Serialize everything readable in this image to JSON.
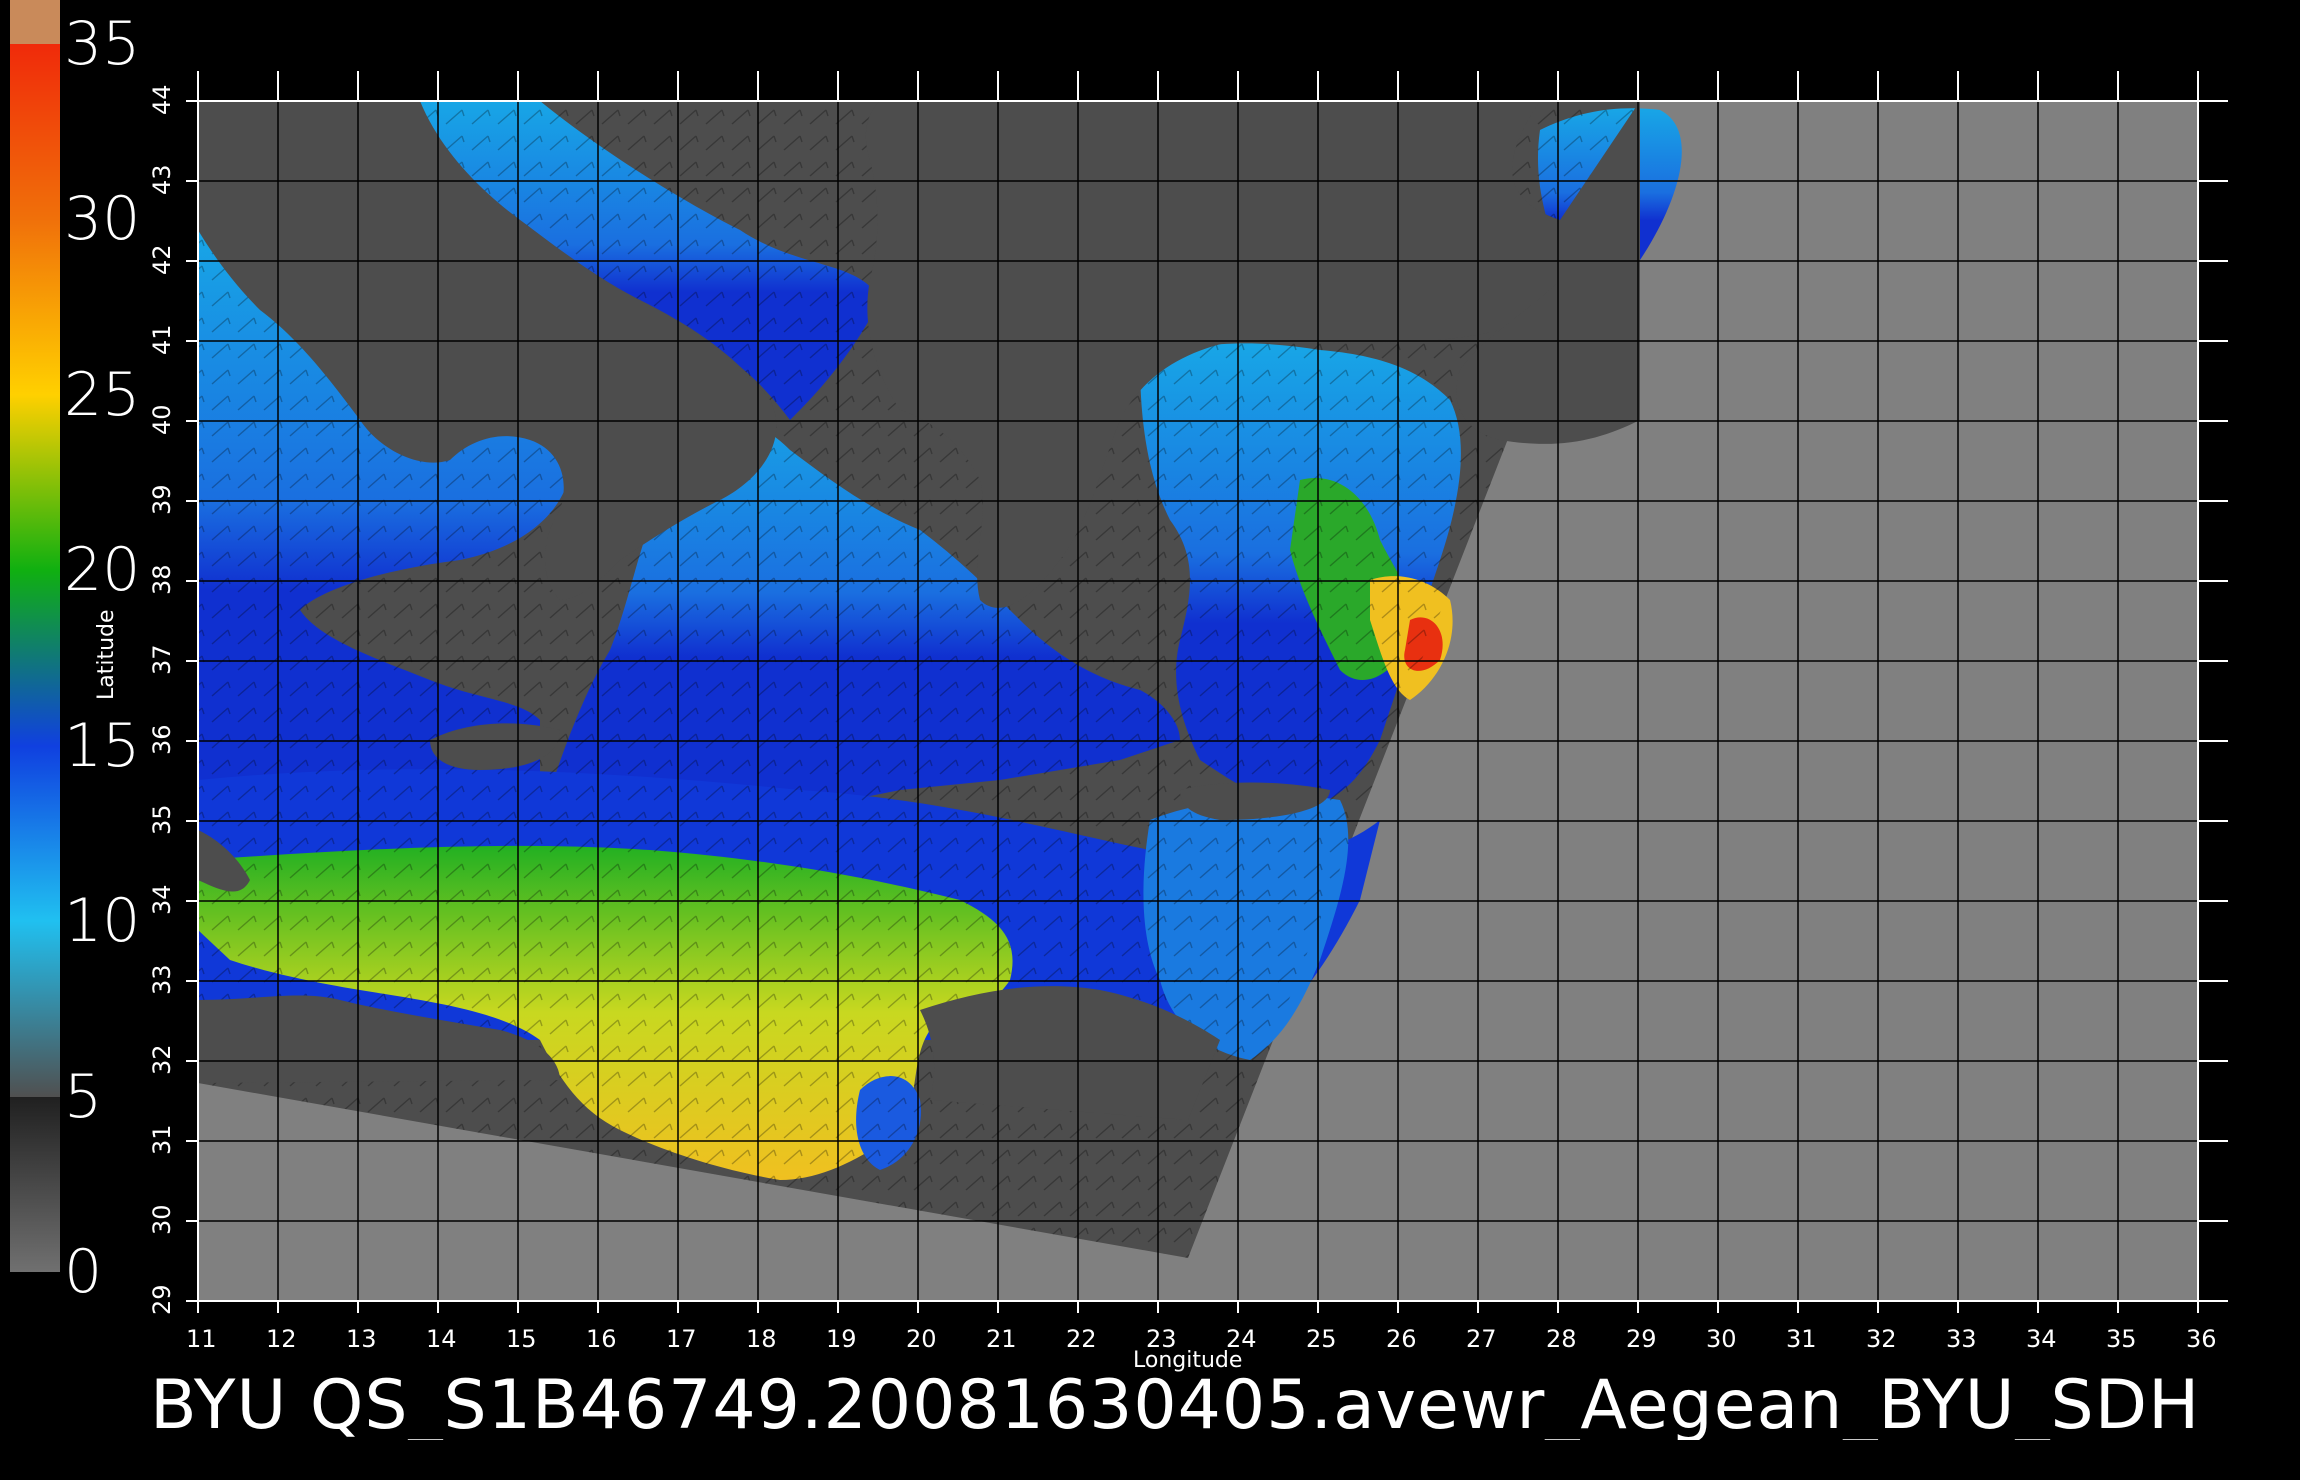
{
  "map": {
    "longitude_range": [
      11,
      36
    ],
    "latitude_range": [
      29,
      44
    ],
    "axis_x_label": "Longitude",
    "axis_y_label": "Latitude",
    "x_ticks": [
      "11",
      "12",
      "13",
      "14",
      "15",
      "16",
      "17",
      "18",
      "19",
      "20",
      "21",
      "22",
      "23",
      "24",
      "25",
      "26",
      "27",
      "28",
      "29",
      "30",
      "31",
      "32",
      "33",
      "34",
      "35",
      "36"
    ],
    "y_ticks": [
      "29",
      "30",
      "31",
      "32",
      "33",
      "34",
      "35",
      "36",
      "37",
      "38",
      "39",
      "40",
      "41",
      "42",
      "43",
      "44"
    ],
    "grid": true,
    "caption": "BYU  QS_S1B46749.20081630405.avewr_Aegean_BYU_SDH"
  },
  "colorbar": {
    "labels": [
      "35",
      "30",
      "25",
      "20",
      "15",
      "10",
      "5",
      "0"
    ],
    "segments": [
      {
        "color": "#c98a5a"
      },
      {
        "color": "#f02a0a"
      },
      {
        "color": "#f0700a"
      },
      {
        "color": "#ffd000"
      },
      {
        "color": "#10b010"
      },
      {
        "color": "#1040e0"
      },
      {
        "color": "#20c0f0"
      },
      {
        "color": "#505050"
      }
    ]
  },
  "colors": {
    "background": "#000000",
    "land": "#4d4d4d",
    "no_data": "#808080",
    "grid": "#000000"
  }
}
